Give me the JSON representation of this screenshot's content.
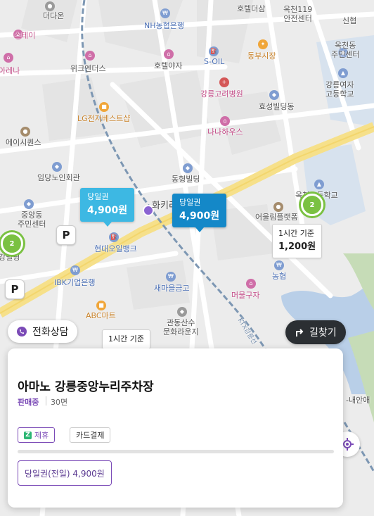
{
  "colors": {
    "accent_purple": "#7b4bb7",
    "price_tag_light": "#3db8e3",
    "price_tag_dark": "#1488c8",
    "cluster_green": "#7ac142",
    "directions_btn": "#2b2f33"
  },
  "map": {
    "labels": {
      "hotel_deodeum": "호텔더삼",
      "okcheon_119": "옥천119\n안전센터",
      "sinhan": "신협",
      "deodaon": "더다온",
      "nh_bank": "NH농협은행",
      "stay": "스테이",
      "areona": "아레나",
      "wicke": "위크엔더스",
      "hotel_yaja": "호텔야자",
      "s_oil": "S-OIL",
      "dongbu_market": "동부시장",
      "okcheon_center": "옥천동\n주민센터",
      "gangneung_girls": "강릉여자\n고등학교",
      "gangneung_hospital": "강릉고려병원",
      "hyoseong": "효성빌딩동",
      "lg_shop": "LG전자베스트샵",
      "nana": "나나하우스",
      "essence": "에이시퀀스",
      "imdang": "임당노인회관",
      "donghyeong": "동형빌딩",
      "okcheon_school": "옥천초등학교",
      "jungang_center": "중앙동\n주민센터",
      "hwapyeongri": "화키리",
      "olympic": "어울림플랫폼",
      "hyundai": "현대오일뱅크",
      "ibk": "IBK기업은행",
      "nonghyup": "농협",
      "saemaeul": "새마을금고",
      "abc_mart": "ABC마트",
      "meoreul": "머물구자",
      "gwandong": "관동산수\n문화라운지",
      "ktx": "KTX강릉선",
      "naeanbeop": "-내안애",
      "building_left": "강빌딩"
    },
    "icons": [
      "bank-icon",
      "hotel-icon",
      "gas-station-icon",
      "market-icon",
      "hospital-icon",
      "school-icon",
      "shop-icon",
      "cafe-icon",
      "building-icon"
    ],
    "price_tags": [
      {
        "type": "당일권",
        "price": "4,900원",
        "style": "light"
      },
      {
        "type": "당일권",
        "price": "4,900원",
        "style": "dark"
      }
    ],
    "hourly_tags": [
      {
        "label": "1시간 기준",
        "price": "1,200원"
      },
      {
        "label": "1시간 기준",
        "price": ""
      }
    ],
    "clusters": [
      "2",
      "2"
    ],
    "parking_marks": [
      "P",
      "P"
    ]
  },
  "buttons": {
    "phone_consult": "전화상담",
    "directions": "길찾기"
  },
  "card": {
    "title": "아마노 강릉중앙누리주차장",
    "status": "판매중",
    "capacity": "30면",
    "badges": {
      "partner": "제휴",
      "card_payment": "카드결제"
    },
    "ticket": "당일권(전일) 4,900원"
  }
}
